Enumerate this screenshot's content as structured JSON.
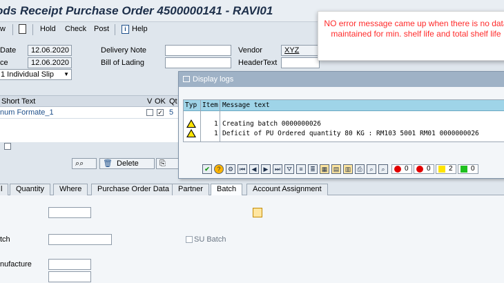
{
  "title": "ods Receipt Purchase Order 4500000141 - RAVI01",
  "toolbar": {
    "w": "w",
    "hold": "Hold",
    "check": "Check",
    "post": "Post",
    "help": "Help"
  },
  "header": {
    "date_label": "Date",
    "date_value": "12.06.2020",
    "ce_label": "ce",
    "ce_value": "12.06.2020",
    "delivery_note_label": "Delivery Note",
    "delivery_note_value": "",
    "bill_of_lading_label": "Bill of Lading",
    "bill_of_lading_value": "",
    "vendor_label": "Vendor",
    "vendor_value": "XYZ",
    "header_text_label": "HeaderText",
    "header_text_value": "",
    "slip_value": "1 Individual Slip"
  },
  "grid": {
    "col_short_text": "Short Text",
    "col_v": "V",
    "col_ok": "OK",
    "col_qt": "Qt",
    "row_text": "num Formate_1",
    "row_qty": "5"
  },
  "actions": {
    "delete": "Delete"
  },
  "tabs": [
    "l",
    "Quantity",
    "Where",
    "Purchase Order Data",
    "Partner",
    "Batch",
    "Account Assignment"
  ],
  "lower": {
    "batch_label": "tch",
    "su_batch_label": "SU Batch",
    "manufacture_label": "nufacture"
  },
  "dialog": {
    "title": "Display logs",
    "col_typ": "Typ",
    "col_item": "Item",
    "col_msg": "Message text",
    "rows": [
      {
        "item": "1",
        "msg": "Creating batch 0000000026"
      },
      {
        "item": "1",
        "msg": "Deficit of PU Ordered quantity 80 KG : RM103 5001 RM01 0000000026"
      }
    ],
    "counts": {
      "stop": "0",
      "error": "0",
      "warning": "2",
      "success": "0"
    }
  },
  "annotation": "NO error message came up when there is no data maintained for min. shelf life and total shelf life"
}
